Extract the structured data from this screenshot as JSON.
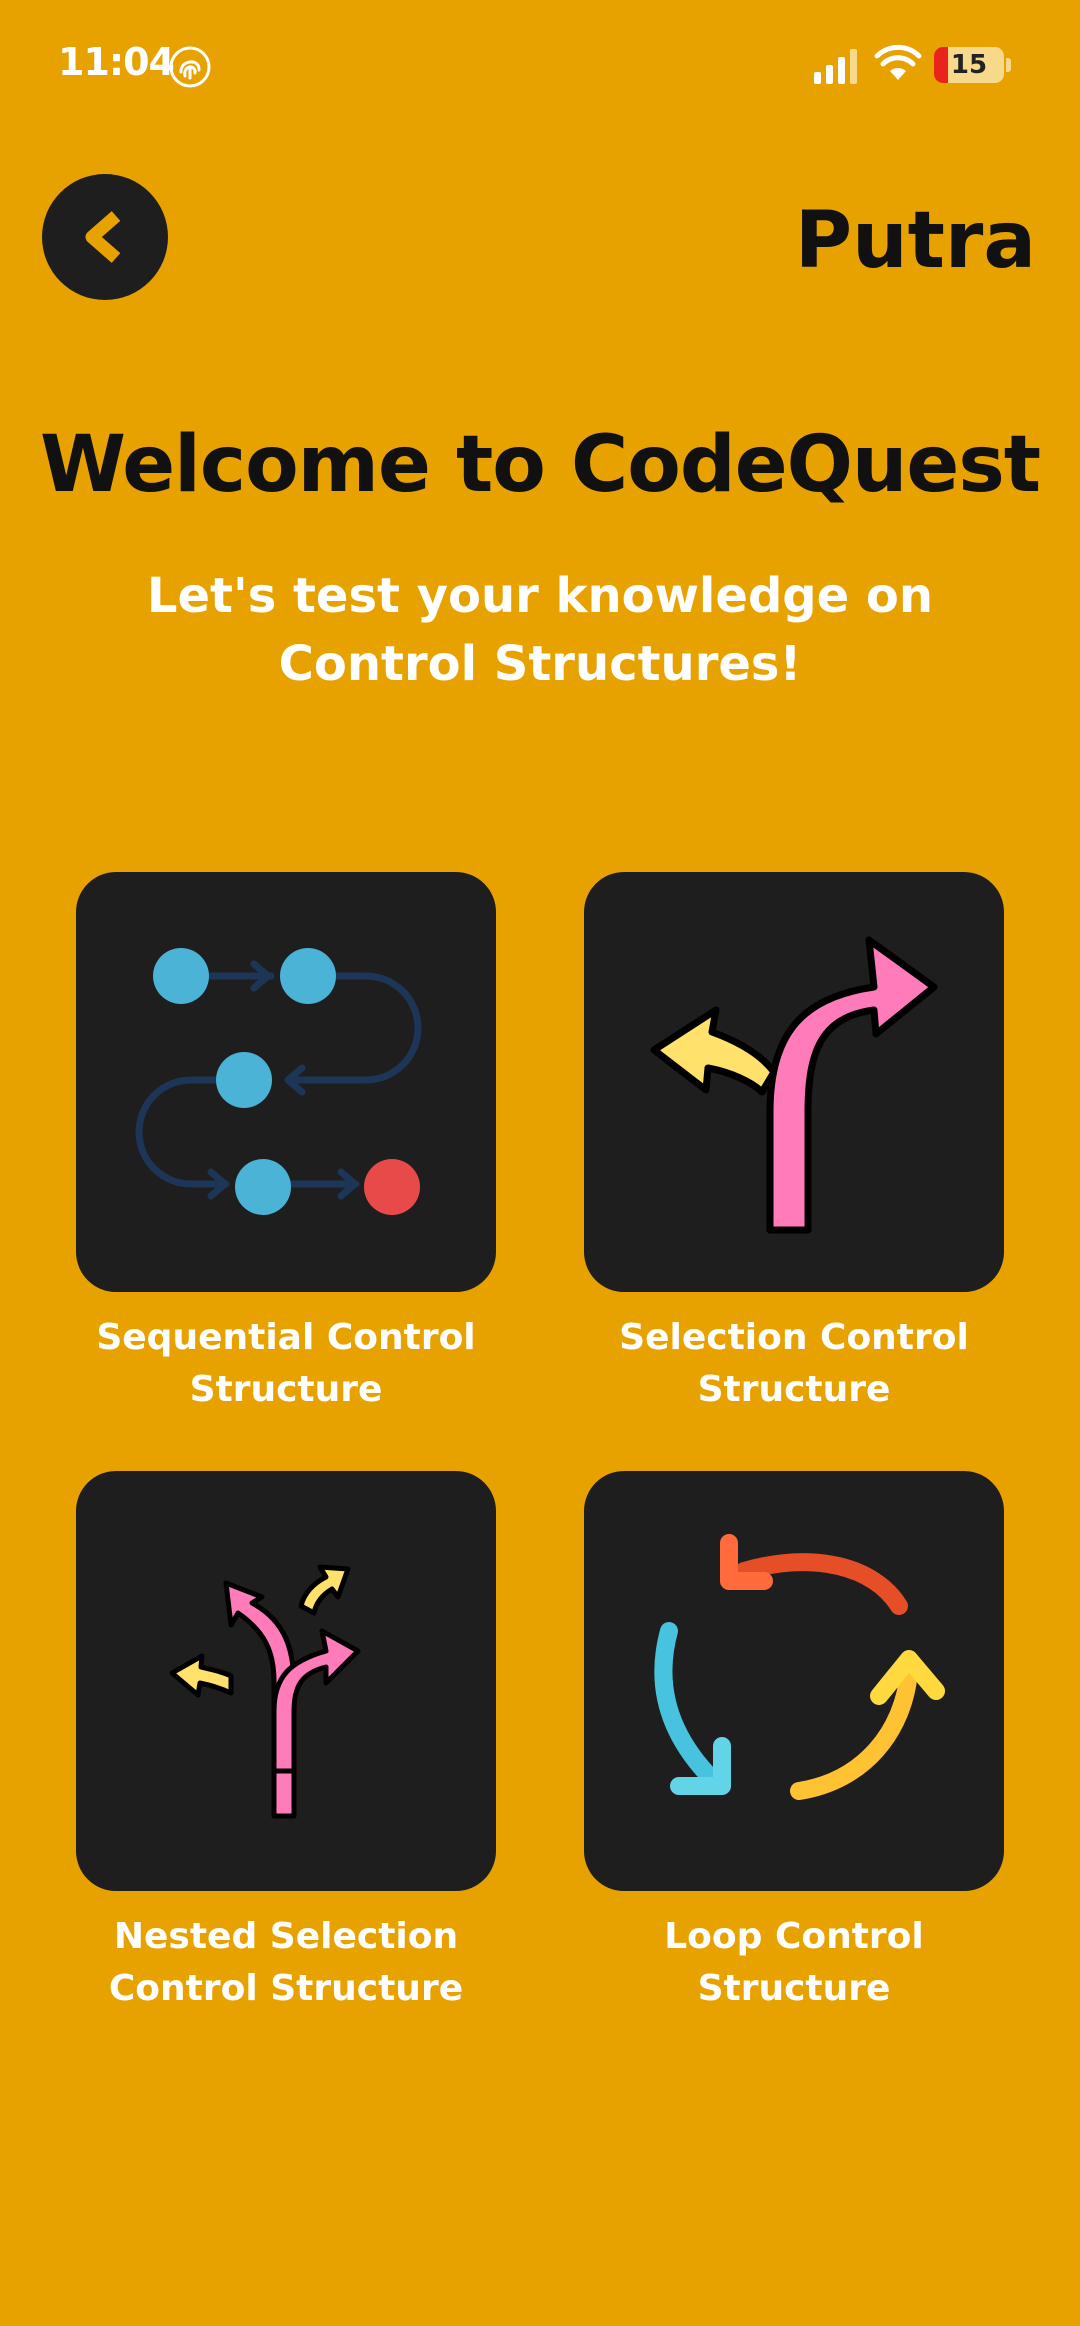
{
  "status_bar": {
    "time": "11:04",
    "battery_percent": "15",
    "icons": [
      "fingerprint-icon",
      "signal-icon",
      "wifi-icon",
      "battery-icon"
    ]
  },
  "header": {
    "back_icon": "chevron-left-icon",
    "user_name": "Putra"
  },
  "main": {
    "title": "Welcome to CodeQuest",
    "subtitle": "Let's test your knowledge on Control Structures!",
    "topics": [
      {
        "label": "Sequential Control Structure",
        "icon": "sequence-flow-icon"
      },
      {
        "label": "Selection Control Structure",
        "icon": "fork-arrows-icon"
      },
      {
        "label": "Nested Selection Control Structure",
        "icon": "nested-fork-arrows-icon"
      },
      {
        "label": "Loop Control Structure",
        "icon": "cycle-arrows-icon"
      }
    ]
  },
  "colors": {
    "background": "#E8A200",
    "card": "#1E1E1E",
    "text_dark": "#111111",
    "text_light": "#FFFFFF"
  }
}
